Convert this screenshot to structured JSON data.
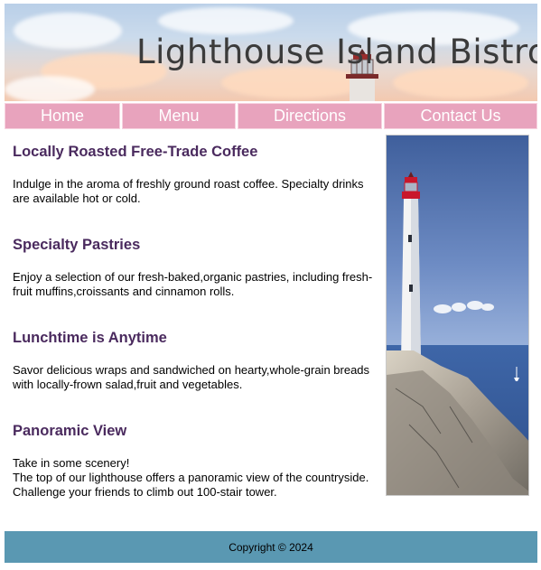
{
  "header": {
    "title": "Lighthouse Island Bistro"
  },
  "nav": {
    "items": [
      "Home",
      "Menu",
      "Directions",
      "Contact Us"
    ]
  },
  "sections": [
    {
      "heading": "Locally Roasted Free-Trade Coffee",
      "text": "Indulge in the aroma of freshly ground roast coffee. Specialty drinks are available hot or cold."
    },
    {
      "heading": "Specialty Pastries",
      "text": "Enjoy a selection of our fresh-baked,organic pastries, including fresh-fruit muffins,croissants and cinnamon rolls."
    },
    {
      "heading": "Lunchtime is Anytime",
      "text": "Savor delicious wraps and sandwiched on hearty,whole-grain breads with locally-frown salad,fruit and vegetables."
    },
    {
      "heading": "Panoramic View",
      "text_line1": "Take in some scenery!",
      "text_line2": "The top of our lighthouse offers a panoramic view of the countryside. Challenge your friends to climb out 100-stair tower."
    }
  ],
  "footer": {
    "copyright": "Copyright © 2024"
  },
  "colors": {
    "nav_bg": "#e8a3bd",
    "heading": "#4a2a5e",
    "footer_bg": "#5a98b2"
  }
}
